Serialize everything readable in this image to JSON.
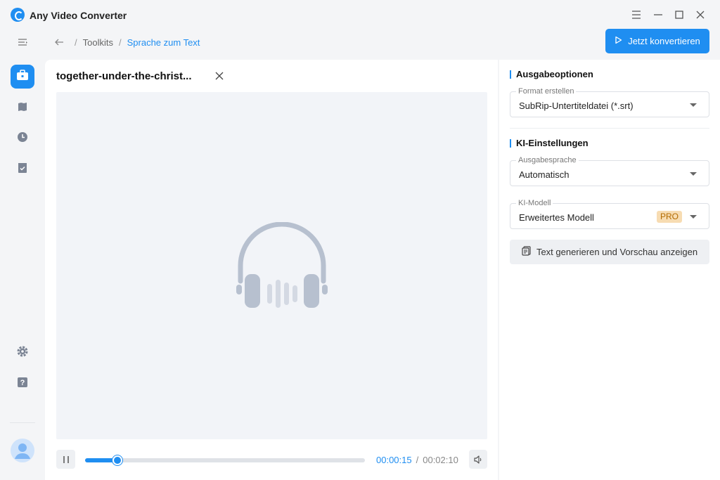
{
  "app": {
    "title": "Any Video Converter"
  },
  "breadcrumb": {
    "parent": "Toolkits",
    "separator": "/",
    "current": "Sprache zum Text"
  },
  "toolbar": {
    "convert_label": "Jetzt konvertieren"
  },
  "file": {
    "name": "together-under-the-christ..."
  },
  "player": {
    "current_time": "00:00:15",
    "total_time": "00:02:10",
    "progress": 0.115
  },
  "output": {
    "section_title": "Ausgabeoptionen",
    "format_label": "Format erstellen",
    "format_value": "SubRip-Untertiteldatei (*.srt)"
  },
  "ai": {
    "section_title": "KI-Einstellungen",
    "language_label": "Ausgabesprache",
    "language_value": "Automatisch",
    "model_label": "KI-Modell",
    "model_value": "Erweitertes Modell",
    "model_badge": "PRO",
    "generate_label": "Text generieren und Vorschau anzeigen"
  },
  "colors": {
    "accent": "#1f8ef1",
    "badge_bg": "#f7dcb2",
    "badge_text": "#b36b00",
    "icon_gray": "#b7c0cf"
  },
  "icons": {
    "rail": [
      "toolbox-icon",
      "library-icon",
      "history-icon",
      "tasks-icon",
      "settings-icon",
      "help-icon"
    ],
    "window": [
      "menu-icon",
      "minimize-icon",
      "maximize-icon",
      "close-icon"
    ]
  }
}
